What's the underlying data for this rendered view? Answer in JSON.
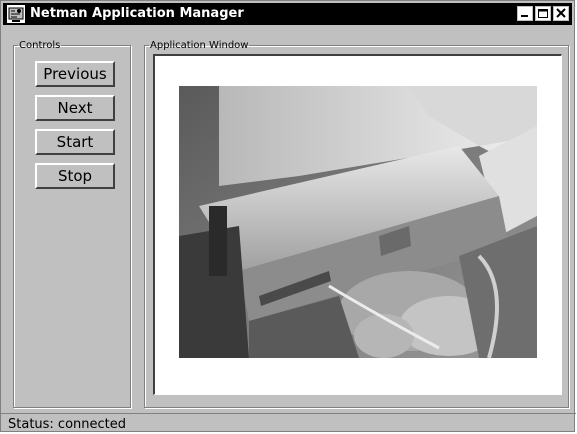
{
  "window": {
    "title": "Netman Application Manager",
    "icon": "app-icon",
    "title_buttons": [
      "minimize-icon",
      "maximize-icon",
      "close-icon"
    ]
  },
  "controls": {
    "legend": "Controls",
    "buttons": {
      "previous": "Previous",
      "next": "Next",
      "start": "Start",
      "stop": "Stop"
    }
  },
  "app_window": {
    "legend": "Application Window",
    "content": "video-frame"
  },
  "status": {
    "text": "Status: connected"
  },
  "colors": {
    "face": "#c0c0c0",
    "titlebar": "#000000",
    "viewport": "#ffffff"
  }
}
